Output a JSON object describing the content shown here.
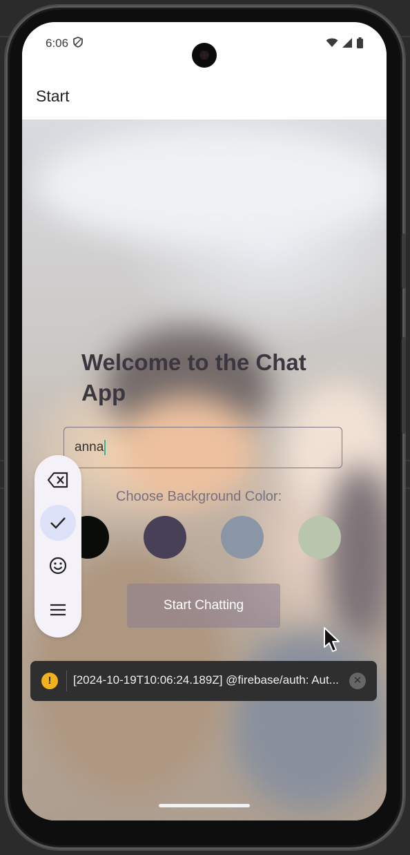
{
  "status_bar": {
    "time": "6:06",
    "icons": [
      "shield-icon",
      "wifi-icon",
      "signal-icon",
      "battery-icon"
    ]
  },
  "app_bar": {
    "title": "Start"
  },
  "start_screen": {
    "welcome": "Welcome to the Chat App",
    "name_input": {
      "value": "anna"
    },
    "choose_label": "Choose Background Color:",
    "colors": [
      "#090C08",
      "#474056",
      "#8A95A5",
      "#B9C6AE"
    ],
    "start_button": "Start Chatting"
  },
  "keyboard_toolbar": {
    "items": [
      "backspace-icon",
      "check-icon",
      "emoji-icon",
      "menu-icon"
    ],
    "active": "check-icon"
  },
  "snackbar": {
    "message": "[2024-10-19T10:06:24.189Z]  @firebase/auth: Aut...",
    "icon": "warning-icon",
    "warn_glyph": "!",
    "close_glyph": "✕",
    "accent": "#F2B21B"
  }
}
